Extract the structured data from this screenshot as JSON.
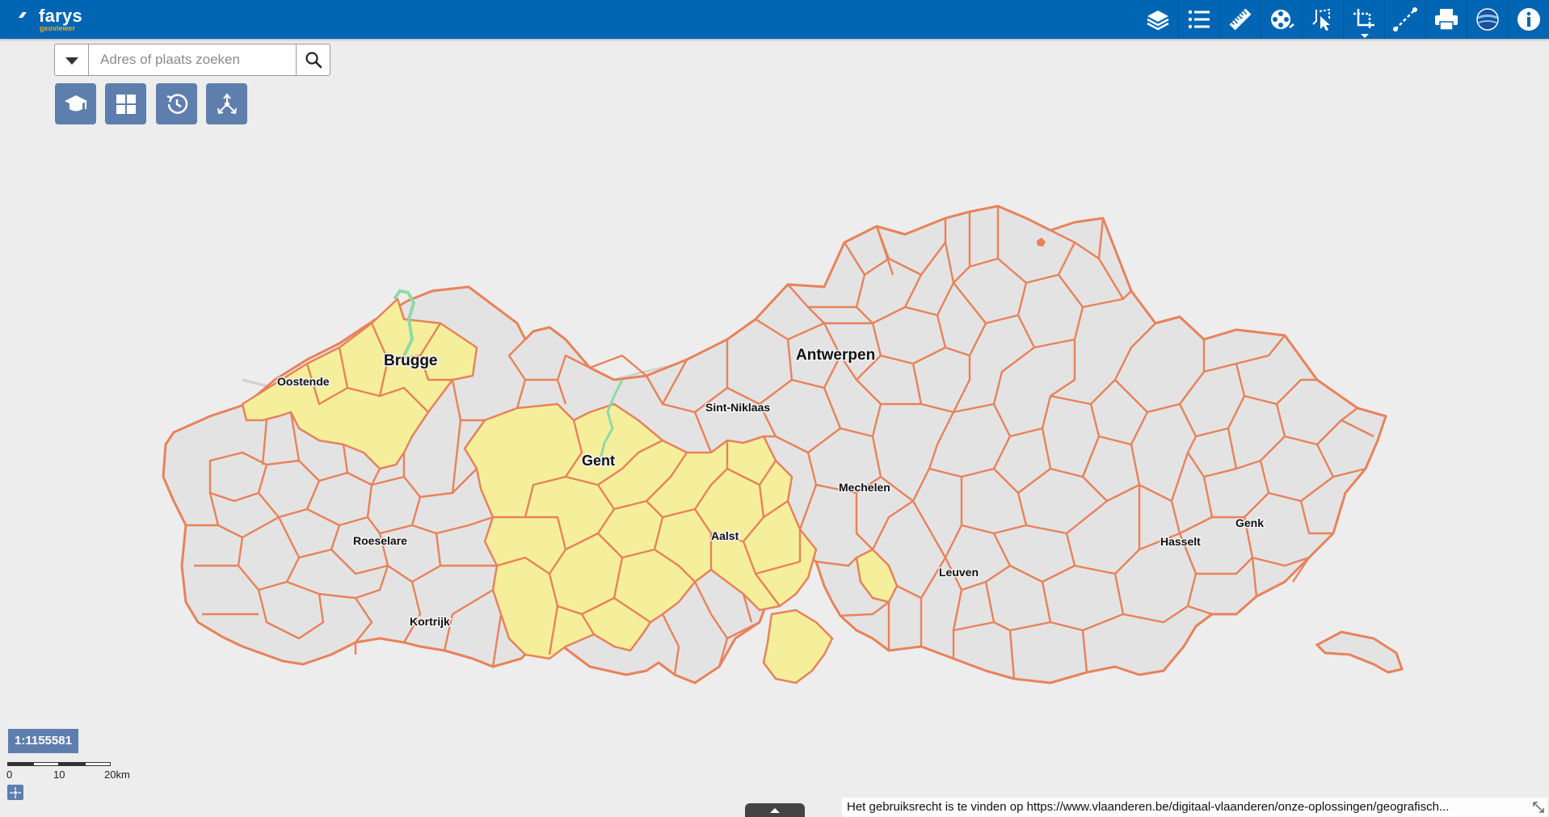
{
  "app": {
    "brand_name": "farys",
    "brand_subtitle": "geoviewer",
    "brand_color": "#0065b3",
    "accent_color": "#f5a623"
  },
  "toolbar": {
    "icons": [
      "layers-icon",
      "legend-list-icon",
      "measure-ruler-icon",
      "film-reel-icon",
      "select-tool-icon",
      "area-select-icon",
      "draw-line-icon",
      "print-icon",
      "globe-icon",
      "info-icon"
    ]
  },
  "search": {
    "placeholder": "Adres of plaats zoeken"
  },
  "quick_buttons": [
    "graduation-cap-icon",
    "grid-icon",
    "history-icon",
    "share-network-icon"
  ],
  "map": {
    "cities": [
      {
        "name": "Antwerpen"
      },
      {
        "name": "Brugge"
      },
      {
        "name": "Gent"
      },
      {
        "name": "Oostende"
      },
      {
        "name": "Sint-Niklaas"
      },
      {
        "name": "Mechelen"
      },
      {
        "name": "Aalst"
      },
      {
        "name": "Roeselare"
      },
      {
        "name": "Leuven"
      },
      {
        "name": "Hasselt"
      },
      {
        "name": "Genk"
      },
      {
        "name": "Kortrijk"
      }
    ],
    "colors": {
      "border": "#e8825a",
      "fill": "#e3e3e3",
      "highlight": "#f5ef9c",
      "water": "#8fd9a8",
      "background": "#ededed"
    }
  },
  "scale": {
    "ratio": "1:1155581",
    "tick_labels": [
      "0",
      "10",
      "20km"
    ]
  },
  "attribution": {
    "text": "Het gebruiksrecht is te vinden op https://www.vlaanderen.be/digitaal-vlaanderen/onze-oplossingen/geografisch..."
  }
}
